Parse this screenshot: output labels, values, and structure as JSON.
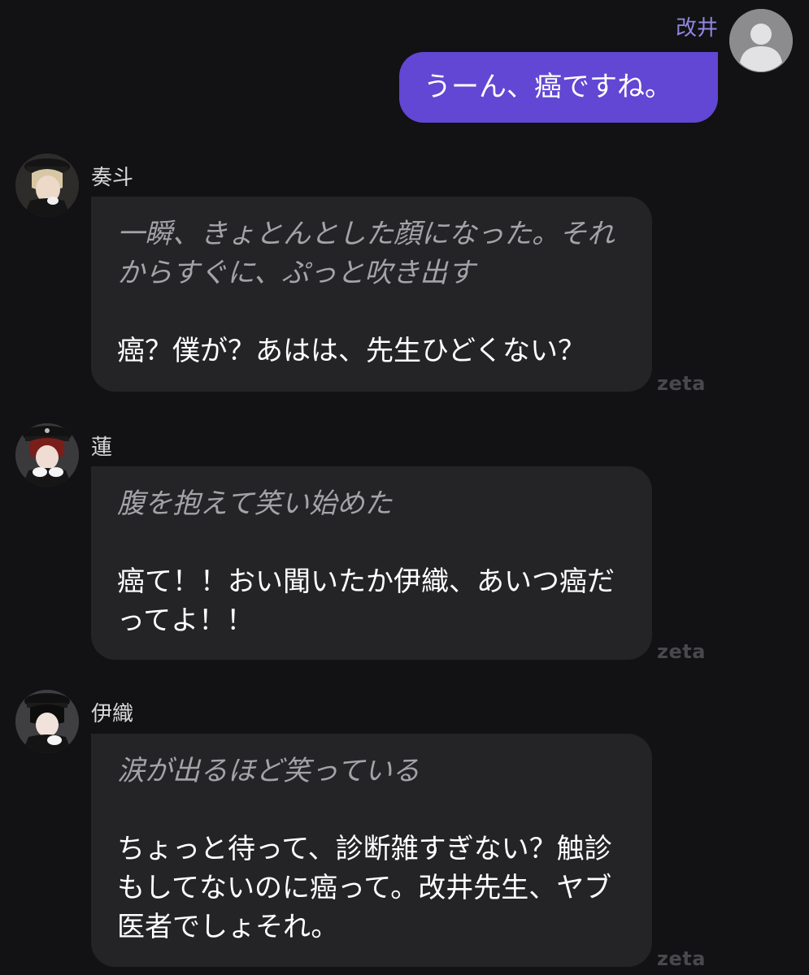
{
  "user_message": {
    "name": "改井",
    "text": "うーん、癌ですね。"
  },
  "messages": [
    {
      "name": "奏斗",
      "narration": "一瞬、きょとんとした顔になった。それからすぐに、ぷっと吹き出す",
      "speech": "癌？僕が？あはは、先生ひどくない？",
      "watermark": "zeta"
    },
    {
      "name": "蓮",
      "narration": "腹を抱えて笑い始めた",
      "speech": "癌て！！おい聞いたか伊織、あいつ癌だってよ！！",
      "watermark": "zeta"
    },
    {
      "name": "伊織",
      "narration": "涙が出るほど笑っている",
      "speech": "ちょっと待って、診断雑すぎない？触診もしてないのに癌って。改井先生、ヤブ医者でしょそれ。",
      "watermark": "zeta"
    }
  ],
  "colors": {
    "background": "#121113",
    "user_bubble": "#6147d3",
    "char_bubble": "#242427",
    "user_name": "#8f86e0"
  }
}
